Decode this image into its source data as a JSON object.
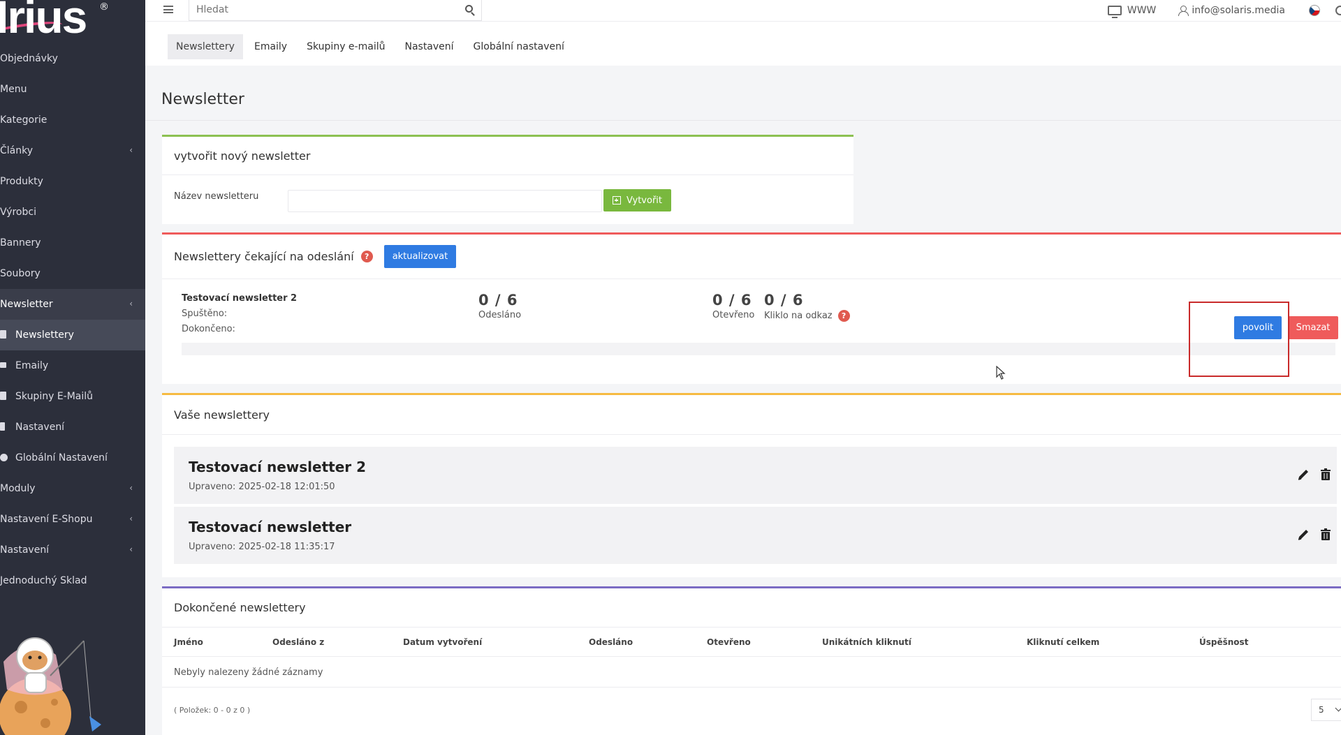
{
  "sidebar": {
    "logo": "Irius",
    "logo_mark": "®",
    "items": [
      {
        "label": "Objednávky"
      },
      {
        "label": "Menu"
      },
      {
        "label": "Kategorie"
      },
      {
        "label": "Články",
        "arrow": "‹"
      },
      {
        "label": "Produkty"
      },
      {
        "label": "Výrobci"
      },
      {
        "label": "Bannery"
      },
      {
        "label": "Soubory"
      },
      {
        "label": "Newsletter",
        "arrow": "‹"
      },
      {
        "label": "Moduly",
        "arrow": "‹"
      },
      {
        "label": "Nastavení E-Shopu",
        "arrow": "‹"
      },
      {
        "label": "Nastavení",
        "arrow": "‹"
      },
      {
        "label": "Jednoduchý Sklad"
      }
    ],
    "newsletter_sub": [
      {
        "label": "Newslettery"
      },
      {
        "label": "Emaily"
      },
      {
        "label": "Skupiny E-Mailů"
      },
      {
        "label": "Nastavení"
      },
      {
        "label": "Globální Nastavení"
      }
    ]
  },
  "topbar": {
    "search_placeholder": "Hledat",
    "www_label": "WWW",
    "user_email": "info@solaris.media"
  },
  "tabs": [
    "Newslettery",
    "Emaily",
    "Skupiny e-mailů",
    "Nastavení",
    "Globální nastavení"
  ],
  "page_title": "Newsletter",
  "create_card": {
    "title": "vytvořit nový newsletter",
    "field_label": "Název newsletteru",
    "field_value": "",
    "button": "Vytvořit"
  },
  "waiting_card": {
    "title": "Newslettery čekající na odeslání",
    "help": "?",
    "refresh_button": "aktualizovat",
    "item": {
      "name": "Testovací newsletter 2",
      "started_label": "Spuštěno:",
      "done_label": "Dokončeno:",
      "sent_value": "0 / 6",
      "sent_label": "Odesláno",
      "opened_value": "0 / 6",
      "opened_label": "Otevřeno",
      "clicked_value": "0 / 6",
      "clicked_label": "Kliklo na odkaz",
      "progress": 0,
      "allow_button": "povolit",
      "delete_button": "Smazat"
    }
  },
  "yours_card": {
    "title": "Vaše newslettery",
    "items": [
      {
        "title": "Testovací newsletter 2",
        "date": "Upraveno: 2025-02-18 12:01:50"
      },
      {
        "title": "Testovací newsletter",
        "date": "Upraveno: 2025-02-18 11:35:17"
      }
    ]
  },
  "done_card": {
    "title": "Dokončené newslettery",
    "columns": [
      "Jméno",
      "Odesláno z",
      "Datum vytvoření",
      "Odesláno",
      "Otevřeno",
      "Unikátních kliknutí",
      "Kliknutí celkem",
      "Úspěšnost"
    ],
    "empty": "Nebyly nalezeny žádné záznamy",
    "pager_info": "( Položek: 0 - 0 z 0 )",
    "per_page": "5"
  },
  "colors": {
    "sidebar_bg": "#2c2f3b",
    "primary": "#2f7be2",
    "success": "#79b83e",
    "danger": "#ef5b5b",
    "warning": "#f6bb42",
    "violet": "#7c6cc4"
  }
}
